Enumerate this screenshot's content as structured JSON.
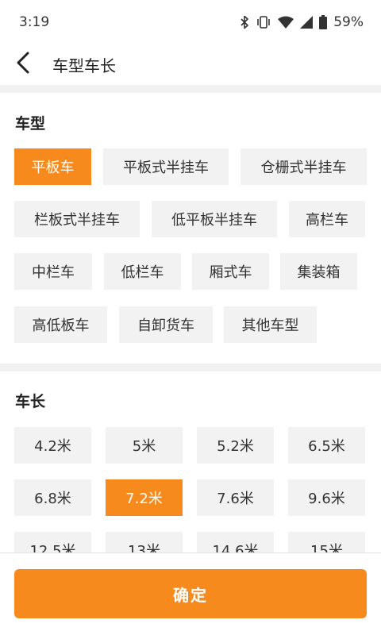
{
  "status_bar": {
    "time": "3:19",
    "battery": "59%",
    "icons": [
      "bluetooth-icon",
      "vibrate-icon",
      "wifi-icon",
      "cell-signal-icon",
      "battery-icon"
    ]
  },
  "header": {
    "title": "车型车长",
    "back_icon": "back-arrow-icon"
  },
  "vehicle_type": {
    "title": "车型",
    "options": [
      {
        "label": "平板车",
        "selected": true
      },
      {
        "label": "平板式半挂车",
        "selected": false
      },
      {
        "label": "仓栅式半挂车",
        "selected": false
      },
      {
        "label": "栏板式半挂车",
        "selected": false
      },
      {
        "label": "低平板半挂车",
        "selected": false
      },
      {
        "label": "高栏车",
        "selected": false
      },
      {
        "label": "中栏车",
        "selected": false
      },
      {
        "label": "低栏车",
        "selected": false
      },
      {
        "label": "厢式车",
        "selected": false
      },
      {
        "label": "集装箱",
        "selected": false
      },
      {
        "label": "高低板车",
        "selected": false
      },
      {
        "label": "自卸货车",
        "selected": false
      },
      {
        "label": "其他车型",
        "selected": false
      }
    ]
  },
  "vehicle_length": {
    "title": "车长",
    "options": [
      {
        "label": "4.2米",
        "selected": false
      },
      {
        "label": "5米",
        "selected": false
      },
      {
        "label": "5.2米",
        "selected": false
      },
      {
        "label": "6.5米",
        "selected": false
      },
      {
        "label": "6.8米",
        "selected": false
      },
      {
        "label": "7.2米",
        "selected": true
      },
      {
        "label": "7.6米",
        "selected": false
      },
      {
        "label": "9.6米",
        "selected": false
      },
      {
        "label": "12.5米",
        "selected": false
      },
      {
        "label": "13米",
        "selected": false
      },
      {
        "label": "14.6米",
        "selected": false
      },
      {
        "label": "15米",
        "selected": false
      }
    ]
  },
  "footer": {
    "confirm_label": "确定"
  },
  "colors": {
    "accent": "#f78a1d",
    "chip_bg": "#f2f2f2",
    "divider": "#f1f1f1"
  }
}
